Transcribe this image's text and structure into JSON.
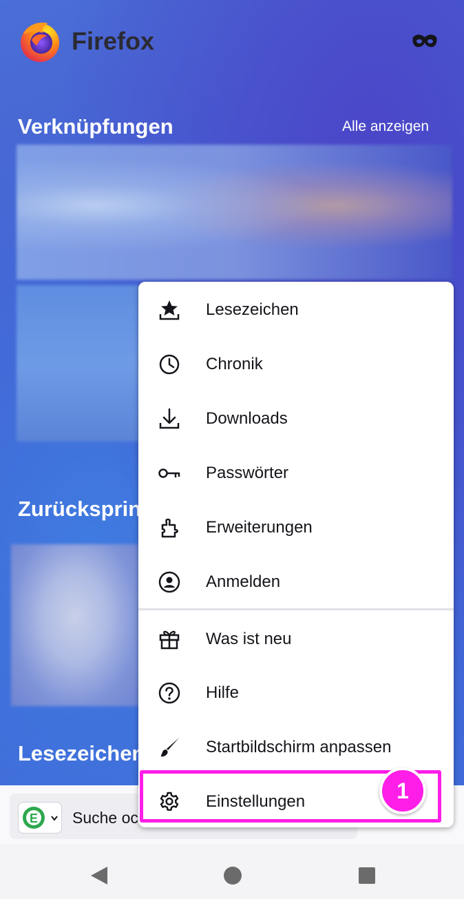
{
  "app": {
    "brand": "Firefox"
  },
  "home": {
    "shortcuts_title": "Verknüpfungen",
    "show_all": "Alle anzeigen",
    "jump_back_title": "Zurückspring",
    "bookmarks_title": "Lesezeichen"
  },
  "menu": {
    "items": [
      {
        "label": "Lesezeichen",
        "icon": "bookmark-star-icon"
      },
      {
        "label": "Chronik",
        "icon": "clock-icon"
      },
      {
        "label": "Downloads",
        "icon": "download-icon"
      },
      {
        "label": "Passwörter",
        "icon": "key-icon"
      },
      {
        "label": "Erweiterungen",
        "icon": "puzzle-icon"
      },
      {
        "label": "Anmelden",
        "icon": "account-icon"
      },
      {
        "label": "Was ist neu",
        "icon": "gift-icon"
      },
      {
        "label": "Hilfe",
        "icon": "help-icon"
      },
      {
        "label": "Startbildschirm anpassen",
        "icon": "paintbrush-icon"
      },
      {
        "label": "Einstellungen",
        "icon": "gear-icon"
      }
    ]
  },
  "annotation": {
    "step": "1",
    "color": "#ff1ee8"
  },
  "toolbar": {
    "search_placeholder": "Suche oc"
  }
}
